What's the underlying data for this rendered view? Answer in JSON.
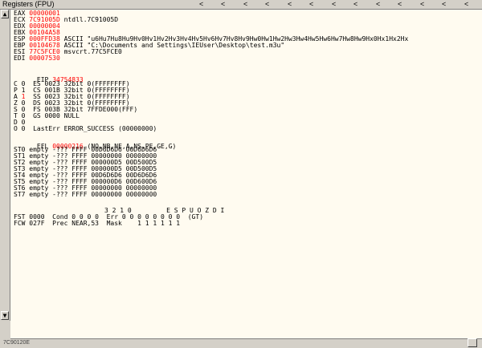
{
  "title": "Registers (FPU)",
  "registers": [
    {
      "name": "EAX",
      "value": "00000001",
      "comment": ""
    },
    {
      "name": "ECX",
      "value": "7C91005D",
      "comment": "ntdll.7C91005D"
    },
    {
      "name": "EDX",
      "value": "00000004",
      "comment": ""
    },
    {
      "name": "EBX",
      "value": "00104A58",
      "comment": ""
    },
    {
      "name": "ESP",
      "value": "000FFD38",
      "comment": "ASCII \"u6Hu7Hu8Hu9Hv0Hv1Hv2Hv3Hv4Hv5Hv6Hv7Hv8Hv9Hw0Hw1Hw2Hw3Hw4Hw5Hw6Hw7Hw8Hw9Hx0Hx1Hx2Hx"
    },
    {
      "name": "EBP",
      "value": "00104678",
      "comment": "ASCII \"C:\\Documents and Settings\\IEUser\\Desktop\\test.m3u\""
    },
    {
      "name": "ESI",
      "value": "77C5FCE0",
      "comment": "msvcrt.77C5FCE0"
    },
    {
      "name": "EDI",
      "value": "00007530",
      "comment": ""
    }
  ],
  "eip": {
    "name": "EIP",
    "value": "34754833"
  },
  "segments": [
    {
      "flag": "C",
      "bit": "0",
      "name": "ES",
      "sel": "0023",
      "desc": "32bit 0(FFFFFFFF)",
      "red": false
    },
    {
      "flag": "P",
      "bit": "1",
      "name": "CS",
      "sel": "001B",
      "desc": "32bit 0(FFFFFFFF)",
      "red": false
    },
    {
      "flag": "A",
      "bit": "1",
      "name": "SS",
      "sel": "0023",
      "desc": "32bit 0(FFFFFFFF)",
      "red": true
    },
    {
      "flag": "Z",
      "bit": "0",
      "name": "DS",
      "sel": "0023",
      "desc": "32bit 0(FFFFFFFF)",
      "red": false
    },
    {
      "flag": "S",
      "bit": "0",
      "name": "FS",
      "sel": "003B",
      "desc": "32bit 7FFDE000(FFF)",
      "red": false
    },
    {
      "flag": "T",
      "bit": "0",
      "name": "GS",
      "sel": "0000",
      "desc": "NULL",
      "red": false
    },
    {
      "flag": "D",
      "bit": "0",
      "name": "",
      "sel": "",
      "desc": "",
      "red": false
    },
    {
      "flag": "O",
      "bit": "0",
      "name": "LastErr",
      "sel": "",
      "desc": "ERROR_SUCCESS (00000000)",
      "red": false
    }
  ],
  "efl": {
    "name": "EFL",
    "value": "00000216",
    "desc": "(NO,NB,NE,A,NS,PE,GE,G)"
  },
  "fpu_stack": [
    {
      "name": "ST0",
      "line": "empty -??? FFFF 00D6D6D6 00D6D6D6"
    },
    {
      "name": "ST1",
      "line": "empty -??? FFFF 00000000 00000000"
    },
    {
      "name": "ST2",
      "line": "empty -??? FFFF 000000D5 00D500D5"
    },
    {
      "name": "ST3",
      "line": "empty -??? FFFF 000000D5 00D500D5"
    },
    {
      "name": "ST4",
      "line": "empty -??? FFFF 00D6D6D6 00D6D6D6"
    },
    {
      "name": "ST5",
      "line": "empty -??? FFFF 000000D6 00D600D6"
    },
    {
      "name": "ST6",
      "line": "empty -??? FFFF 00000000 00000000"
    },
    {
      "name": "ST7",
      "line": "empty -??? FFFF 00000000 00000000"
    }
  ],
  "fpu_header": "3 2 1 0         E S P U O Z D I",
  "fst_line": "FST 0000  Cond 0 0 0 0  Err 0 0 0 0 0 0 0 0  (GT)",
  "fcw_line": "FCW 027F  Prec NEAR,53  Mask    1 1 1 1 1 1",
  "status_text": "7C90120E"
}
